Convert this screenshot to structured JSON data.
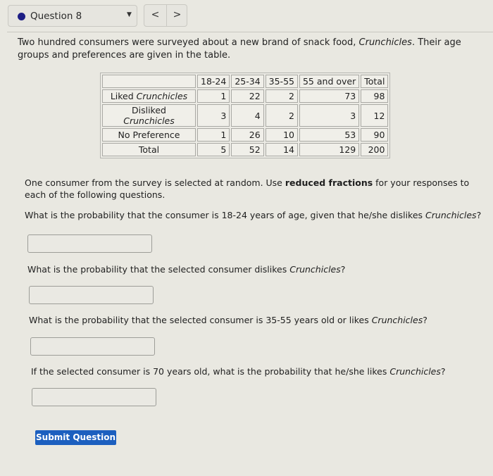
{
  "header": {
    "question_select": {
      "label": "Question 8",
      "status_color": "#1d1e85",
      "icon": "chevron-down-icon"
    },
    "nav": {
      "prev_glyph": "<",
      "next_glyph": ">"
    }
  },
  "intro": {
    "text_before": "Two hundred consumers were surveyed about a new brand of snack food, ",
    "brand": "Crunchicles",
    "text_after": ". Their age groups and preferences are given in the table."
  },
  "table": {
    "columns": [
      "",
      "18-24",
      "25-34",
      "35-55",
      "55 and over",
      "Total"
    ],
    "rows": [
      {
        "label_prefix": "Liked ",
        "label_brand": "Crunchicles",
        "values": [
          "1",
          "22",
          "2",
          "73",
          "98"
        ]
      },
      {
        "label_prefix": "Disliked ",
        "label_brand": "Crunchicles",
        "values": [
          "3",
          "4",
          "2",
          "3",
          "12"
        ]
      },
      {
        "label_prefix": "No Preference",
        "label_brand": "",
        "values": [
          "1",
          "26",
          "10",
          "53",
          "90"
        ]
      },
      {
        "label_prefix": "Total",
        "label_brand": "",
        "values": [
          "5",
          "52",
          "14",
          "129",
          "200"
        ]
      }
    ]
  },
  "instructions": {
    "before": "One consumer from the survey is selected at random. Use ",
    "bold": "reduced fractions",
    "after": " for your responses to each of the following questions."
  },
  "questions": [
    {
      "before": "What is the probability that the consumer is 18-24 years of age, given that he/she dislikes ",
      "brand": "Crunchicles",
      "after": "?",
      "answer": ""
    },
    {
      "before": "What is the probability that the selected consumer dislikes ",
      "brand": "Crunchicles",
      "after": "?",
      "answer": ""
    },
    {
      "before": "What is the probability that the selected consumer is 35-55 years old or likes ",
      "brand": "Crunchicles",
      "after": "?",
      "answer": ""
    },
    {
      "before": "If the selected consumer is 70 years old, what is the probability that he/she likes ",
      "brand": "Crunchicles",
      "after": "?",
      "answer": ""
    }
  ],
  "submit": {
    "label": "Submit Question"
  }
}
